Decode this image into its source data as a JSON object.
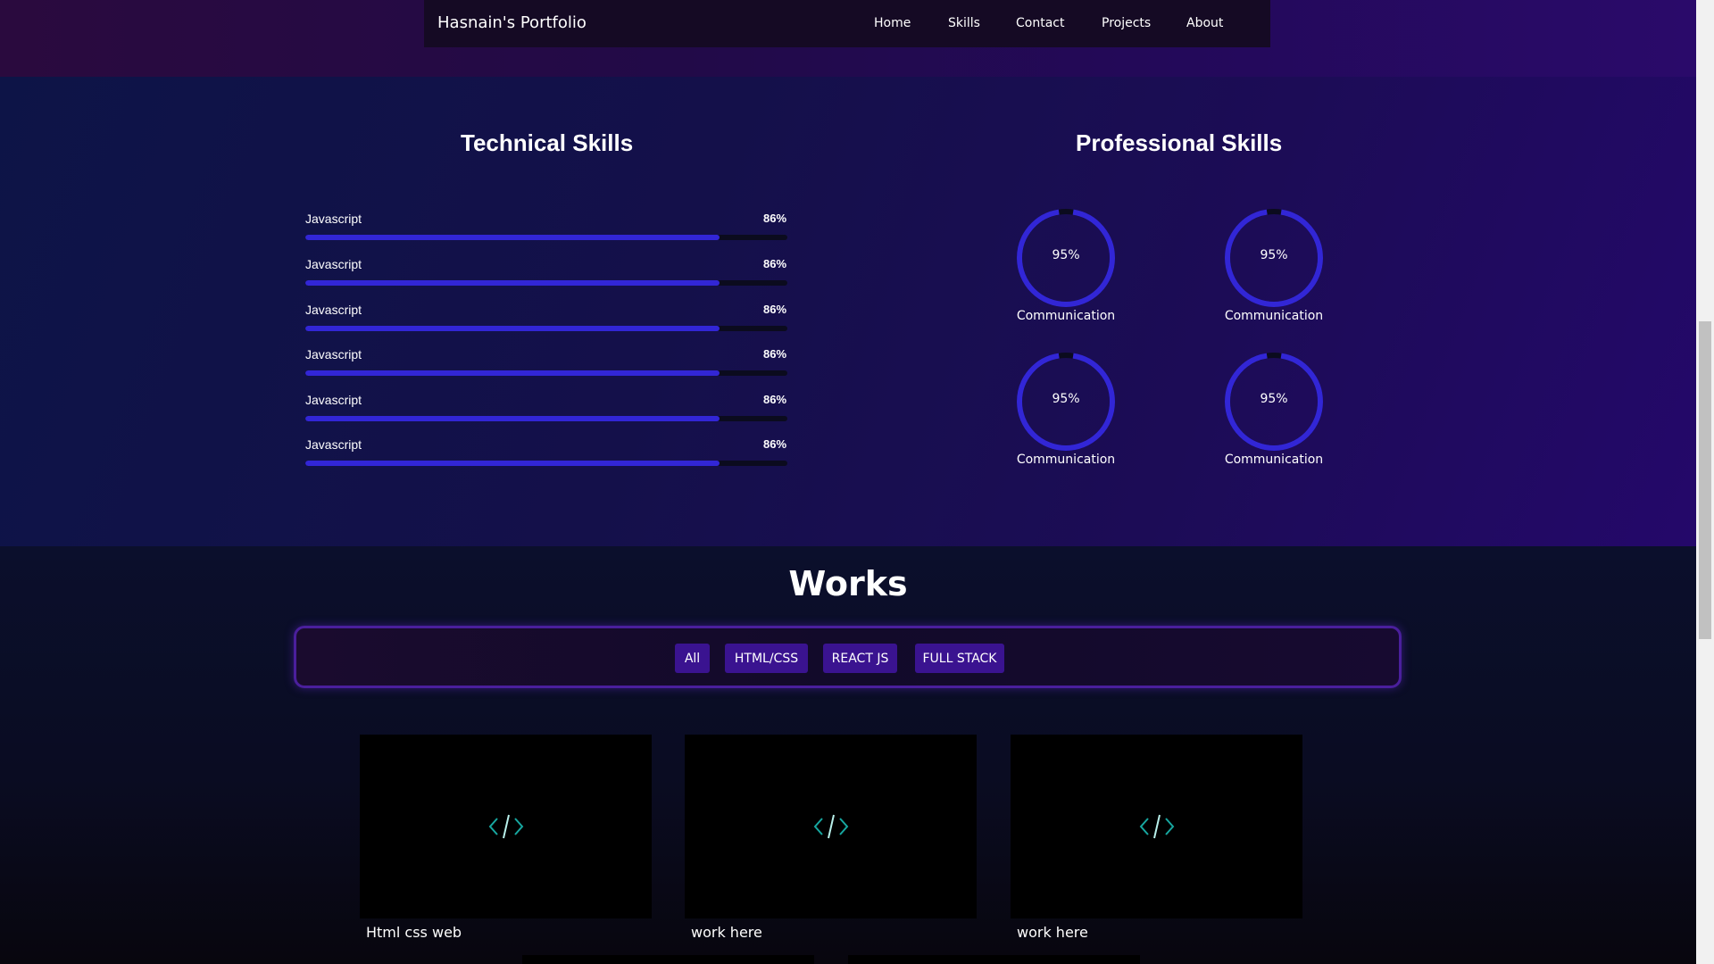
{
  "nav": {
    "brand": "Hasnain's Portfolio",
    "links": [
      "Home",
      "Skills",
      "Contact",
      "Projects",
      "About"
    ]
  },
  "skills": {
    "technical_title": "Technical Skills",
    "professional_title": "Professional Skills",
    "technical": [
      {
        "label": "Javascript",
        "percent_text": "86%",
        "level": 86
      },
      {
        "label": "Javascript",
        "percent_text": "86%",
        "level": 86
      },
      {
        "label": "Javascript",
        "percent_text": "86%",
        "level": 86
      },
      {
        "label": "Javascript",
        "percent_text": "86%",
        "level": 86
      },
      {
        "label": "Javascript",
        "percent_text": "86%",
        "level": 86
      },
      {
        "label": "Javascript",
        "percent_text": "86%",
        "level": 86
      }
    ],
    "professional": [
      {
        "label": "Communication",
        "percent_text": "95%",
        "level": 95
      },
      {
        "label": "Communication",
        "percent_text": "95%",
        "level": 95
      },
      {
        "label": "Communication",
        "percent_text": "95%",
        "level": 95
      },
      {
        "label": "Communication",
        "percent_text": "95%",
        "level": 95
      }
    ]
  },
  "works": {
    "title": "Works",
    "filters": [
      "All",
      "HTML/CSS",
      "REACT JS",
      "FULL STACK"
    ],
    "cards": [
      {
        "caption": "Html css web",
        "icon": "code-icon"
      },
      {
        "caption": "work here",
        "icon": "code-icon"
      },
      {
        "caption": "work here",
        "icon": "code-icon"
      }
    ]
  },
  "colors": {
    "accent": "#3226d6",
    "filter_button": "#3a1390",
    "code_icon": "#17a7a0"
  }
}
